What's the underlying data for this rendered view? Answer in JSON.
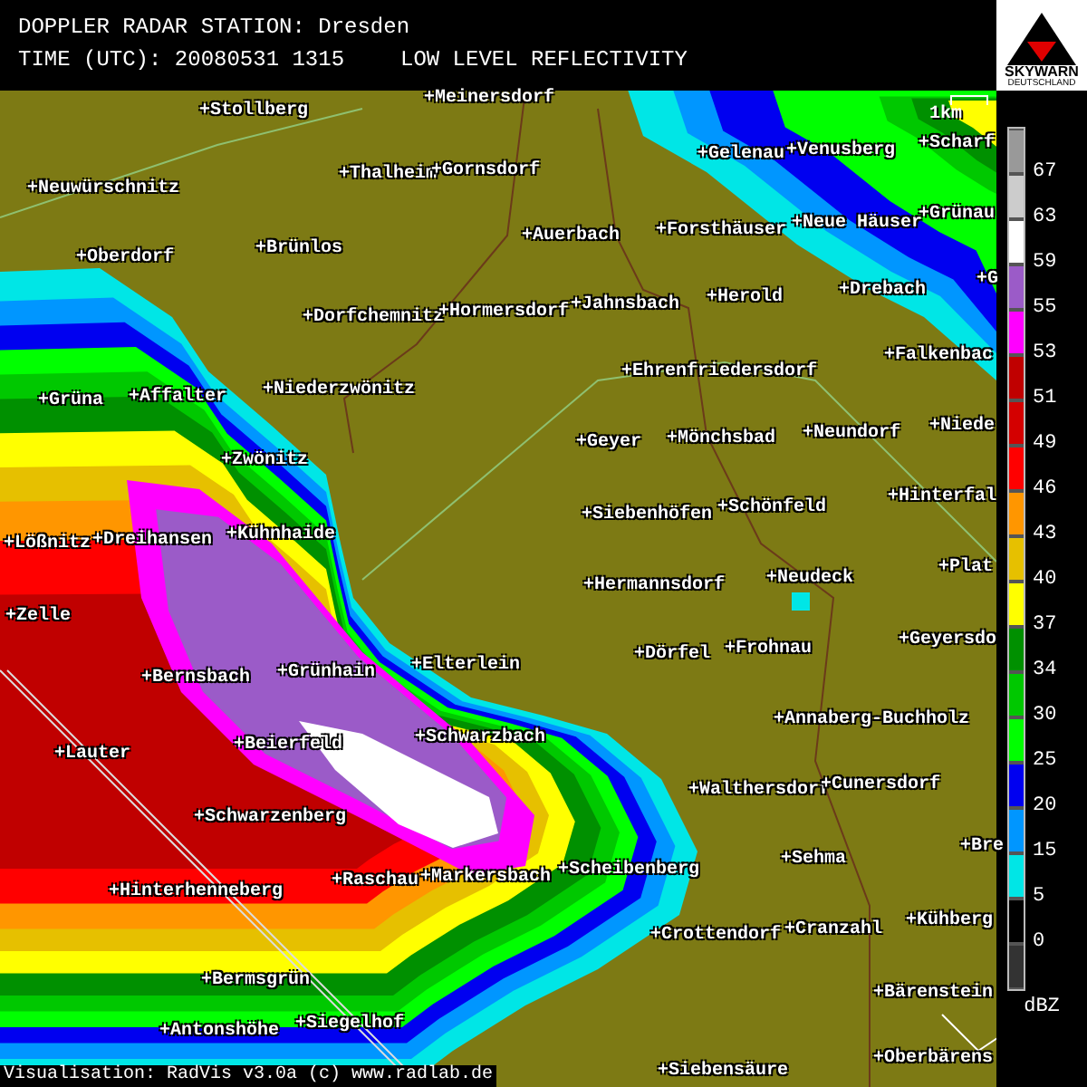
{
  "header": {
    "station": "DOPPLER RADAR STATION: Dresden",
    "time": "TIME (UTC): 20080531 1315",
    "product": "LOW LEVEL REFLECTIVITY"
  },
  "logo": {
    "name": "SKYWARN",
    "country": "DEUTSCHLAND"
  },
  "map": {
    "scale": "1km",
    "places": [
      "+Meinersdorf",
      "+Stollberg",
      "+Neuwürschnitz",
      "+Thalheim",
      "+Gornsdorf",
      "+Brünlos",
      "+Oberdorf",
      "+Auerbach",
      "+Forsthäuser",
      "+Neue Häuser",
      "+Gelenau",
      "+Venusberg",
      "+Scharf",
      "+Grünau",
      "+G",
      "+Drebach",
      "+Herold",
      "+Jahnsbach",
      "+Dorfchemnitz",
      "+Hormersdorf",
      "+Falkenbac",
      "+Ehrenfriedersdorf",
      "+Niederzwönitz",
      "+Grüna",
      "+Affalter",
      "+Geyer",
      "+Mönchsbad",
      "+Neundorf",
      "+Niede",
      "+Zwönitz",
      "+Siebenhöfen",
      "+Schönfeld",
      "+Hinterfal",
      "+Kühnhaide",
      "+Lößnitz",
      "+Dreihansen",
      "+Plat",
      "+Hermannsdorf",
      "+Neudeck",
      "+Zelle",
      "+Elterlein",
      "+Dörfel",
      "+Frohnau",
      "+Geyersdo",
      "+Bernsbach",
      "+Grünhain",
      "+Annaberg-Buchholz",
      "+Lauter",
      "+Beierfeld",
      "+Schwarzbach",
      "+Walthersdorf",
      "+Cunersdorf",
      "+Schwarzenberg",
      "+Sehma",
      "+Bre",
      "+Hinterhenneberg",
      "+Raschau",
      "+Markersbach",
      "+Scheibenberg",
      "+Crottendorf",
      "+Cranzahl",
      "+Kühberg",
      "+Bermsgrün",
      "+Bärenstein",
      "+Antonshöhe",
      "+Siegelhof",
      "+Oberbärens",
      "+Siebensäure"
    ]
  },
  "legend": {
    "steps": [
      {
        "label": "67",
        "color": "#999999"
      },
      {
        "label": "63",
        "color": "#cccccc"
      },
      {
        "label": "59",
        "color": "#ffffff"
      },
      {
        "label": "55",
        "color": "#9b5bc8"
      },
      {
        "label": "53",
        "color": "#ff00ff"
      },
      {
        "label": "51",
        "color": "#c00000"
      },
      {
        "label": "49",
        "color": "#d40000"
      },
      {
        "label": "46",
        "color": "#ff0000"
      },
      {
        "label": "43",
        "color": "#ff9600"
      },
      {
        "label": "40",
        "color": "#e6c000"
      },
      {
        "label": "37",
        "color": "#ffff00"
      },
      {
        "label": "34",
        "color": "#009000"
      },
      {
        "label": "30",
        "color": "#00c800"
      },
      {
        "label": "25",
        "color": "#00ff00"
      },
      {
        "label": "20",
        "color": "#0000f0"
      },
      {
        "label": "15",
        "color": "#0096ff"
      },
      {
        "label": "5",
        "color": "#00e6e6"
      },
      {
        "label": "0",
        "color": "#000000"
      },
      {
        "color": "#333333"
      }
    ],
    "unit": "dBZ"
  },
  "footer": "Visualisation: RadVis v3.0a (c) www.radlab.de"
}
